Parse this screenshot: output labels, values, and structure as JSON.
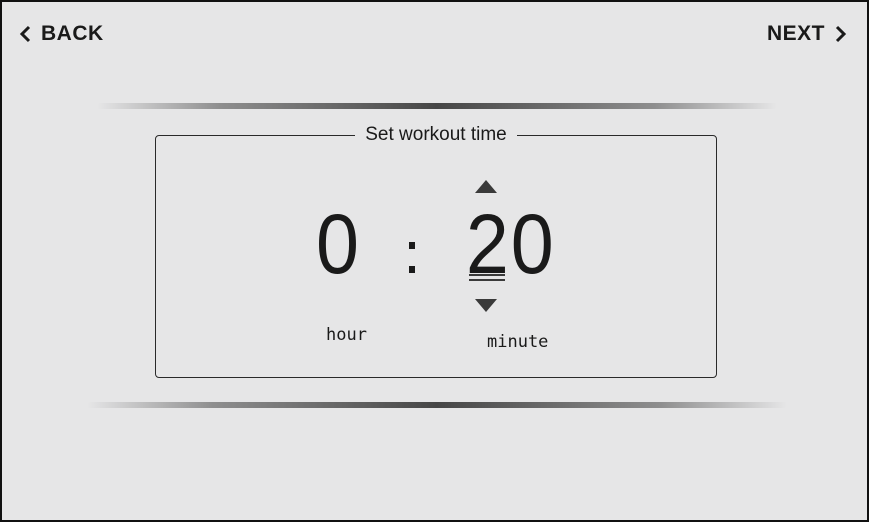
{
  "nav": {
    "back_label": "BACK",
    "next_label": "NEXT",
    "back_icon": "chevron-left-icon",
    "next_icon": "chevron-right-icon"
  },
  "timer": {
    "title": "Set workout time",
    "hour": "0",
    "separator": ":",
    "minute": "20",
    "hour_label": "hour",
    "minute_label": "minute",
    "increment_icon": "triangle-up-icon",
    "decrement_icon": "triangle-down-icon",
    "active_field": "minute"
  },
  "colors": {
    "background": "#e6e6e7",
    "text": "#1a1a1a",
    "frame_border": "#111111"
  }
}
